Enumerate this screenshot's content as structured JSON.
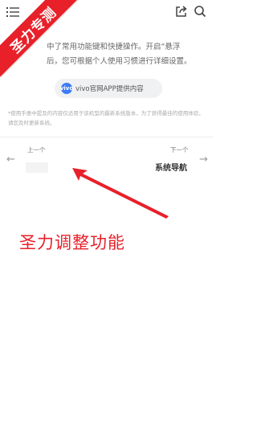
{
  "watermark": {
    "text": "圣力专测",
    "color": "#e8202a"
  },
  "toolbar": {
    "menu_icon": "menu-icon",
    "share_icon": "share-icon",
    "search_icon": "search-icon"
  },
  "content": {
    "intro_line1": "中了常用功能键和快捷操作。开启“悬浮",
    "intro_line2": "后，您可根据个人使用习惯进行详细设置。",
    "vivo_logo_text": "vivo",
    "vivo_badge_label": "vivo官网APP提供内容",
    "disclaimer": "*使用手册中提及的内容仅适用于该机型的最新系统版本，为了获得最佳的使用体验，请您及时更新系统。"
  },
  "pager": {
    "prev_label": "上一个",
    "next_label": "下一个",
    "next_title": "系统导航",
    "prev_arrow": "←",
    "next_arrow": "→"
  },
  "annotation": {
    "text": "圣力调整功能",
    "color": "#e8202a"
  }
}
